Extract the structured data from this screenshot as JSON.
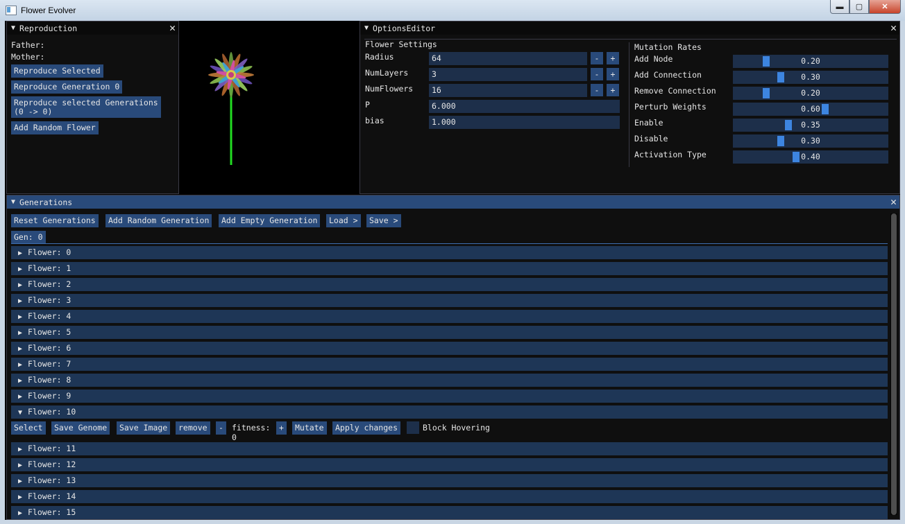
{
  "window": {
    "title": "Flower Evolver",
    "min": "▬",
    "max": "▢",
    "close": "✕"
  },
  "reproduction": {
    "title": "Reproduction",
    "father_label": "Father:",
    "mother_label": "Mother:",
    "btn_selected": "Reproduce Selected",
    "btn_generation": "Reproduce Generation 0",
    "btn_selected_generations_1": "Reproduce selected Generations",
    "btn_selected_generations_2": "(0 -> 0)",
    "btn_random_flower": "Add Random Flower"
  },
  "options": {
    "title": "OptionsEditor",
    "flower_settings": {
      "heading": "Flower Settings",
      "fields": [
        {
          "label": "Radius",
          "value": "64",
          "minus": "-",
          "plus": "+"
        },
        {
          "label": "NumLayers",
          "value": "3",
          "minus": "-",
          "plus": "+"
        },
        {
          "label": "NumFlowers",
          "value": "16",
          "minus": "-",
          "plus": "+"
        },
        {
          "label": "P",
          "value": "6.000"
        },
        {
          "label": "bias",
          "value": "1.000"
        }
      ]
    },
    "mutation_rates": {
      "heading": "Mutation Rates",
      "sliders": [
        {
          "label": "Add Node",
          "value": "0.20",
          "fraction": 0.2
        },
        {
          "label": "Add Connection",
          "value": "0.30",
          "fraction": 0.3
        },
        {
          "label": "Remove Connection",
          "value": "0.20",
          "fraction": 0.2
        },
        {
          "label": "Perturb Weights",
          "value": "0.60",
          "fraction": 0.6
        },
        {
          "label": "Enable",
          "value": "0.35",
          "fraction": 0.35
        },
        {
          "label": "Disable",
          "value": "0.30",
          "fraction": 0.3
        },
        {
          "label": "Activation Type",
          "value": "0.40",
          "fraction": 0.4
        }
      ]
    }
  },
  "generations": {
    "title": "Generations",
    "toolbar": {
      "reset": "Reset Generations",
      "add_random": "Add Random Generation",
      "add_empty": "Add Empty Generation",
      "load": "Load >",
      "save": "Save >"
    },
    "tab": "Gen: 0",
    "flowers_before": [
      "Flower: 0",
      "Flower: 1",
      "Flower: 2",
      "Flower: 3",
      "Flower: 4",
      "Flower: 5",
      "Flower: 6",
      "Flower: 7",
      "Flower: 8",
      "Flower: 9"
    ],
    "expanded": {
      "label": "Flower: 10",
      "select": "Select",
      "save_genome": "Save Genome",
      "save_image": "Save Image",
      "remove": "remove",
      "minus": "-",
      "fitness_label": "fitness:",
      "fitness_value": "0",
      "plus": "+",
      "mutate": "Mutate",
      "apply": "Apply changes",
      "block_hovering": "Block Hovering"
    },
    "flowers_after": [
      "Flower: 11",
      "Flower: 12",
      "Flower: 13",
      "Flower: 14",
      "Flower: 15"
    ]
  }
}
